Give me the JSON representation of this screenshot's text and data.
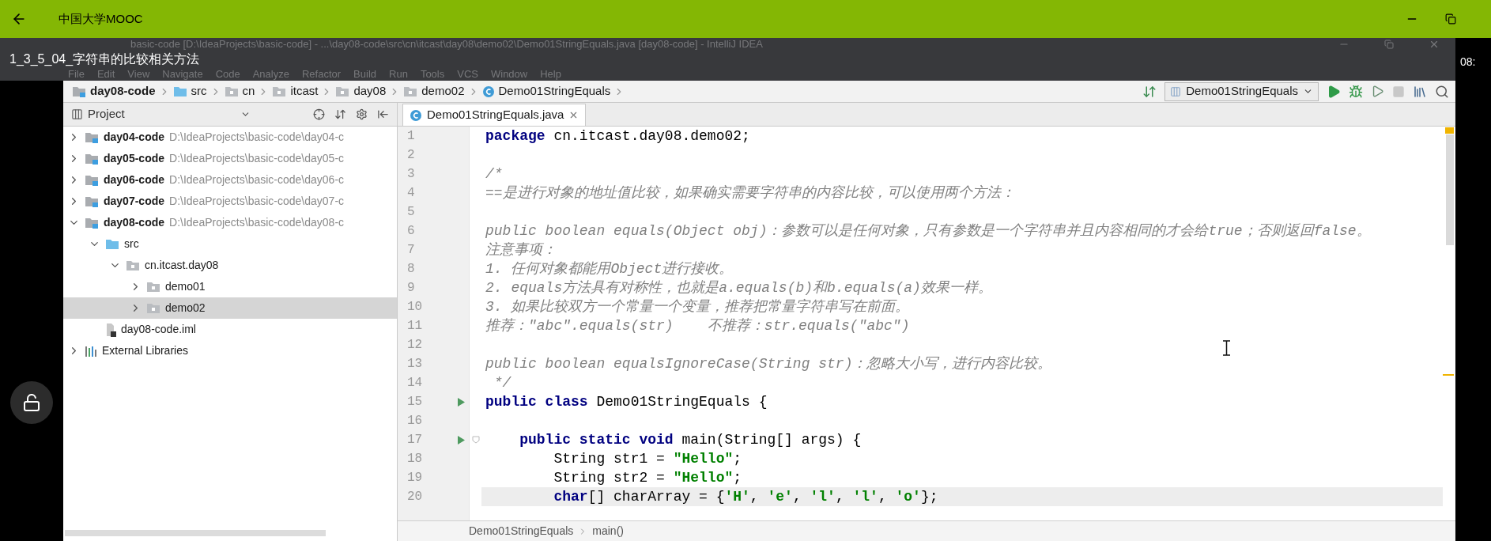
{
  "app_bar": {
    "title": "中国大学MOOC"
  },
  "video": {
    "title": "1_3_5_04_字符串的比较相关方法",
    "time": "08:"
  },
  "ide": {
    "window_title": "basic-code [D:\\IdeaProjects\\basic-code] - ...\\day08-code\\src\\cn\\itcast\\day08\\demo02\\Demo01StringEquals.java [day08-code] - IntelliJ IDEA",
    "menu": [
      "File",
      "Edit",
      "View",
      "Navigate",
      "Code",
      "Analyze",
      "Refactor",
      "Build",
      "Run",
      "Tools",
      "VCS",
      "Window",
      "Help"
    ],
    "breadcrumb": [
      {
        "kind": "module",
        "label": "day08-code"
      },
      {
        "kind": "source",
        "label": "src"
      },
      {
        "kind": "package",
        "label": "cn"
      },
      {
        "kind": "package",
        "label": "itcast"
      },
      {
        "kind": "package",
        "label": "day08"
      },
      {
        "kind": "package",
        "label": "demo02"
      },
      {
        "kind": "class",
        "label": "Demo01StringEquals"
      }
    ],
    "run_config": "Demo01StringEquals",
    "project_panel": {
      "title": "Project",
      "tree": [
        {
          "kind": "module",
          "name": "day04-code",
          "path": "D:\\IdeaProjects\\basic-code\\day04-c",
          "expanded": false,
          "selected": false
        },
        {
          "kind": "module",
          "name": "day05-code",
          "path": "D:\\IdeaProjects\\basic-code\\day05-c",
          "expanded": false,
          "selected": false
        },
        {
          "kind": "module",
          "name": "day06-code",
          "path": "D:\\IdeaProjects\\basic-code\\day06-c",
          "expanded": false,
          "selected": false
        },
        {
          "kind": "module",
          "name": "day07-code",
          "path": "D:\\IdeaProjects\\basic-code\\day07-c",
          "expanded": false,
          "selected": false
        },
        {
          "kind": "module",
          "name": "day08-code",
          "path": "D:\\IdeaProjects\\basic-code\\day08-c",
          "expanded": true,
          "selected": false,
          "children": [
            {
              "kind": "source",
              "name": "src",
              "expanded": true,
              "selected": false,
              "children": [
                {
                  "kind": "package",
                  "name": "cn.itcast.day08",
                  "expanded": true,
                  "selected": false,
                  "children": [
                    {
                      "kind": "package",
                      "name": "demo01",
                      "expanded": false,
                      "selected": false
                    },
                    {
                      "kind": "package",
                      "name": "demo02",
                      "expanded": false,
                      "selected": true
                    }
                  ]
                }
              ]
            },
            {
              "kind": "file",
              "name": "day08-code.iml",
              "selected": false
            }
          ]
        },
        {
          "kind": "library",
          "name": "External Libraries",
          "expanded": false,
          "selected": false
        }
      ]
    },
    "editor": {
      "tabs": [
        {
          "label": "Demo01StringEquals.java",
          "selected": true
        }
      ],
      "lines": [
        {
          "num": "1",
          "tokens": [
            {
              "kind": "keyword",
              "text": "package"
            },
            {
              "kind": "plain",
              "text": " cn.itcast.day08.demo02;"
            }
          ]
        },
        {
          "num": "2"
        },
        {
          "num": "3",
          "tokens": [
            {
              "kind": "comment",
              "text": "/*"
            }
          ]
        },
        {
          "num": "4",
          "tokens": [
            {
              "kind": "comment",
              "text": "==是进行对象的地址值比较，如果确实需要字符串的内容比较，可以使用两个方法："
            }
          ]
        },
        {
          "num": "5"
        },
        {
          "num": "6",
          "tokens": [
            {
              "kind": "comment",
              "text": "public boolean equals(Object obj)：参数可以是任何对象，只有参数是一个字符串并且内容相同的才会给true；否则返回false。"
            }
          ]
        },
        {
          "num": "7",
          "tokens": [
            {
              "kind": "comment",
              "text": "注意事项："
            }
          ]
        },
        {
          "num": "8",
          "tokens": [
            {
              "kind": "comment",
              "text": "1. 任何对象都能用Object进行接收。"
            }
          ]
        },
        {
          "num": "9",
          "tokens": [
            {
              "kind": "comment",
              "text": "2. equals方法具有对称性，也就是a.equals(b)和b.equals(a)效果一样。"
            }
          ]
        },
        {
          "num": "10",
          "tokens": [
            {
              "kind": "comment",
              "text": "3. 如果比较双方一个常量一个变量，推荐把常量字符串写在前面。"
            }
          ]
        },
        {
          "num": "11",
          "tokens": [
            {
              "kind": "comment",
              "text": "推荐：\"abc\".equals(str)    不推荐：str.equals(\"abc\")"
            }
          ]
        },
        {
          "num": "12"
        },
        {
          "num": "13",
          "tokens": [
            {
              "kind": "comment",
              "text": "public boolean equalsIgnoreCase(String str)：忽略大小写，进行内容比较。"
            }
          ]
        },
        {
          "num": "14",
          "tokens": [
            {
              "kind": "comment",
              "text": " */"
            }
          ]
        },
        {
          "num": "15",
          "run_marker": true,
          "tokens": [
            {
              "kind": "keyword",
              "text": "public class"
            },
            {
              "kind": "plain",
              "text": " Demo01StringEquals {"
            }
          ]
        },
        {
          "num": "16"
        },
        {
          "num": "17",
          "run_marker": true,
          "fold_marker": true,
          "tokens": [
            {
              "kind": "keyword",
              "text": "    public static void"
            },
            {
              "kind": "plain",
              "text": " main(String[] args) {"
            }
          ]
        },
        {
          "num": "18",
          "tokens": [
            {
              "kind": "plain",
              "text": "        String str1 = "
            },
            {
              "kind": "string",
              "text": "\"Hello\""
            },
            {
              "kind": "plain",
              "text": ";"
            }
          ]
        },
        {
          "num": "19",
          "tokens": [
            {
              "kind": "plain",
              "text": "        String str2 = "
            },
            {
              "kind": "string",
              "text": "\"Hello\""
            },
            {
              "kind": "plain",
              "text": ";"
            }
          ]
        },
        {
          "num": "20",
          "current": true,
          "tokens": [
            {
              "kind": "keyword",
              "text": "        char"
            },
            {
              "kind": "plain",
              "text": "[] charArray = {"
            },
            {
              "kind": "string",
              "text": "'H'"
            },
            {
              "kind": "plain",
              "text": ", "
            },
            {
              "kind": "string",
              "text": "'e'"
            },
            {
              "kind": "plain",
              "text": ", "
            },
            {
              "kind": "string",
              "text": "'l'"
            },
            {
              "kind": "plain",
              "text": ", "
            },
            {
              "kind": "string",
              "text": "'l'"
            },
            {
              "kind": "plain",
              "text": ", "
            },
            {
              "kind": "string",
              "text": "'o'"
            },
            {
              "kind": "plain",
              "text": "};"
            }
          ]
        }
      ],
      "footer_breadcrumb": [
        "Demo01StringEquals",
        "main()"
      ]
    }
  }
}
